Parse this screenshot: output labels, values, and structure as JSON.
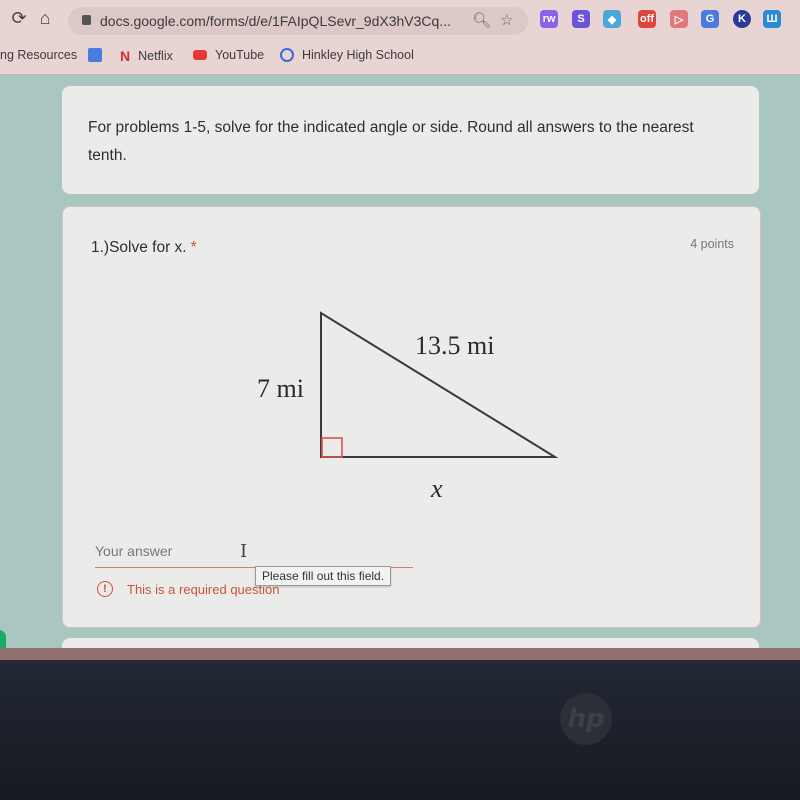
{
  "browser": {
    "nav": {
      "reload_icon": "⟳",
      "home_icon": "⌂"
    },
    "url": "docs.google.com/forms/d/e/1FAIpQLSevr_9dX3hV3Cq...",
    "extensions": [
      {
        "name": "extension-puzzle-icon",
        "glyph": "rw",
        "color": "#8a63e8"
      },
      {
        "name": "extension-s-icon",
        "glyph": "S",
        "color": "#6a55d8"
      },
      {
        "name": "extension-diamond-icon",
        "glyph": "◆",
        "color": "#4aa8d8"
      },
      {
        "name": "extension-off-icon",
        "glyph": "off",
        "color": "#e0443a"
      },
      {
        "name": "extension-arrow-icon",
        "glyph": "▷",
        "color": "#e07a7a"
      },
      {
        "name": "extension-translate-icon",
        "glyph": "G",
        "color": "#4a7be0"
      },
      {
        "name": "extension-k-icon",
        "glyph": "K",
        "color": "#2a3a9a"
      },
      {
        "name": "extension-m-icon",
        "glyph": "Ш",
        "color": "#2a8ad8"
      }
    ]
  },
  "bookmarks": [
    {
      "label": "ng Resources",
      "icon": "none",
      "color": ""
    },
    {
      "label": "",
      "icon": "google-docs-icon",
      "color": "#4a7be0"
    },
    {
      "label": "Netflix",
      "icon": "netflix-icon",
      "color": "#d32f2f"
    },
    {
      "label": "YouTube",
      "icon": "youtube-icon",
      "color": "#e53935"
    },
    {
      "label": "Hinkley High School",
      "icon": "school-icon",
      "color": "#3a6ad8"
    }
  ],
  "intro": {
    "text": "For problems 1-5, solve for the indicated angle or side. Round all answers to the nearest tenth."
  },
  "question": {
    "title": "1.)Solve for x.",
    "required_mark": "*",
    "points": "4 points",
    "diagram": {
      "type": "right-triangle",
      "vertical_leg_label": "7 mi",
      "hypotenuse_label": "13.5 mi",
      "horizontal_leg_label": "x",
      "right_angle_marker_color": "#d9534f"
    },
    "answer_placeholder": "Your answer",
    "answer_value": "",
    "error_text": "This is a required question",
    "tooltip": "Please fill out this field."
  },
  "device": {
    "logo": "hp"
  }
}
